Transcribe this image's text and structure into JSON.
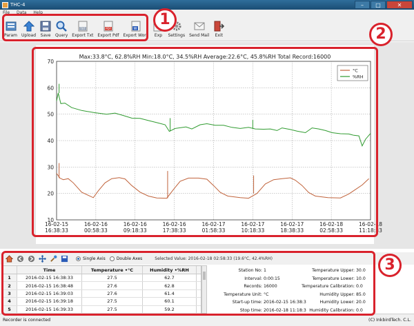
{
  "window": {
    "title": "THC-4"
  },
  "menu": [
    "File",
    "Data",
    "Help"
  ],
  "toolbar": [
    {
      "label": "Param",
      "icon": "param-icon"
    },
    {
      "label": "Upload",
      "icon": "upload-icon"
    },
    {
      "label": "Save",
      "icon": "save-icon"
    },
    {
      "label": "Query",
      "icon": "query-icon"
    },
    {
      "label": "Export Txt",
      "icon": "export-txt-icon"
    },
    {
      "label": "Export Pdf",
      "icon": "export-pdf-icon"
    },
    {
      "label": "Export Word",
      "icon": "export-word-icon"
    },
    {
      "label": "Exp",
      "icon": "export-icon"
    },
    {
      "label": "Settings",
      "icon": "settings-icon"
    },
    {
      "label": "Send Mail",
      "icon": "mail-icon"
    },
    {
      "label": "Exit",
      "icon": "exit-icon"
    }
  ],
  "annotations": [
    "1",
    "2",
    "3"
  ],
  "stats_text": "Max:33.8°C, 62.8%RH  Min:18.0°C, 34.5%RH  Average:22.6°C, 45.8%RH  Total Record:16000",
  "chart_data": {
    "type": "line",
    "ylim": [
      10,
      70
    ],
    "yticks": [
      10,
      20,
      30,
      40,
      50,
      60,
      70
    ],
    "xticks": [
      {
        "date": "16-02-15",
        "time": "16:38:33"
      },
      {
        "date": "16-02-16",
        "time": "00:58:33"
      },
      {
        "date": "16-02-16",
        "time": "09:18:33"
      },
      {
        "date": "16-02-16",
        "time": "17:38:33"
      },
      {
        "date": "16-02-17",
        "time": "01:58:33"
      },
      {
        "date": "16-02-17",
        "time": "10:18:33"
      },
      {
        "date": "16-02-17",
        "time": "18:38:33"
      },
      {
        "date": "16-02-18",
        "time": "02:58:33"
      },
      {
        "date": "16-02-18",
        "time": "11:18:33"
      }
    ],
    "grid": true,
    "legend_position": "top-right",
    "series": [
      {
        "name": "°C",
        "color": "#c0623a",
        "points": [
          [
            0,
            27.6
          ],
          [
            0.04,
            25.8
          ],
          [
            0.08,
            25.2
          ],
          [
            0.14,
            25.6
          ],
          [
            0.2,
            24.0
          ],
          [
            0.3,
            20.5
          ],
          [
            0.44,
            18.4
          ],
          [
            0.5,
            21.0
          ],
          [
            0.58,
            24.0
          ],
          [
            0.66,
            25.6
          ],
          [
            0.75,
            26.0
          ],
          [
            0.82,
            25.5
          ],
          [
            0.9,
            23.0
          ],
          [
            1.0,
            20.5
          ],
          [
            1.1,
            19.0
          ],
          [
            1.2,
            18.3
          ],
          [
            1.32,
            18.2
          ],
          [
            1.4,
            21.5
          ],
          [
            1.48,
            24.6
          ],
          [
            1.58,
            25.8
          ],
          [
            1.7,
            25.8
          ],
          [
            1.8,
            25.4
          ],
          [
            1.88,
            23.0
          ],
          [
            1.96,
            20.4
          ],
          [
            2.05,
            19.0
          ],
          [
            2.2,
            18.4
          ],
          [
            2.3,
            18.2
          ],
          [
            2.4,
            20.0
          ],
          [
            2.5,
            23.6
          ],
          [
            2.6,
            25.2
          ],
          [
            2.7,
            25.6
          ],
          [
            2.8,
            25.9
          ],
          [
            2.86,
            25.0
          ],
          [
            2.94,
            23.0
          ],
          [
            3.02,
            20.3
          ],
          [
            3.1,
            19.0
          ],
          [
            3.25,
            18.4
          ],
          [
            3.4,
            18.3
          ],
          [
            3.5,
            19.8
          ],
          [
            3.58,
            21.5
          ],
          [
            3.66,
            23.2
          ],
          [
            3.74,
            25.6
          ]
        ]
      },
      {
        "name": "%RH",
        "color": "#2f9b2f",
        "points": [
          [
            0,
            55.0
          ],
          [
            0.02,
            58.0
          ],
          [
            0.05,
            54.0
          ],
          [
            0.1,
            54.2
          ],
          [
            0.18,
            52.5
          ],
          [
            0.3,
            51.4
          ],
          [
            0.45,
            50.6
          ],
          [
            0.6,
            50.0
          ],
          [
            0.7,
            50.4
          ],
          [
            0.8,
            49.5
          ],
          [
            0.9,
            48.5
          ],
          [
            1.0,
            48.4
          ],
          [
            1.1,
            47.6
          ],
          [
            1.2,
            46.8
          ],
          [
            1.3,
            46.0
          ],
          [
            1.35,
            43.5
          ],
          [
            1.42,
            44.6
          ],
          [
            1.55,
            45.2
          ],
          [
            1.62,
            44.4
          ],
          [
            1.72,
            46.0
          ],
          [
            1.8,
            46.4
          ],
          [
            1.9,
            45.8
          ],
          [
            2.0,
            45.8
          ],
          [
            2.1,
            45.0
          ],
          [
            2.2,
            44.6
          ],
          [
            2.3,
            45.0
          ],
          [
            2.38,
            44.4
          ],
          [
            2.48,
            44.3
          ],
          [
            2.56,
            44.4
          ],
          [
            2.64,
            43.8
          ],
          [
            2.7,
            44.8
          ],
          [
            2.8,
            44.2
          ],
          [
            2.88,
            43.6
          ],
          [
            2.98,
            43.0
          ],
          [
            3.06,
            44.8
          ],
          [
            3.14,
            44.4
          ],
          [
            3.22,
            43.8
          ],
          [
            3.3,
            43.0
          ],
          [
            3.4,
            42.6
          ],
          [
            3.5,
            42.5
          ],
          [
            3.56,
            42.0
          ],
          [
            3.62,
            41.8
          ],
          [
            3.66,
            38.0
          ],
          [
            3.7,
            40.5
          ],
          [
            3.76,
            42.7
          ]
        ]
      }
    ],
    "x_range": [
      0,
      3.76
    ],
    "spikes": [
      {
        "series": 0,
        "x": 0.03,
        "y": 31.5
      },
      {
        "series": 1,
        "x": 0.03,
        "y": 61.5
      },
      {
        "series": 0,
        "x": 1.33,
        "y": 28.5
      },
      {
        "series": 1,
        "x": 1.36,
        "y": 48.5
      },
      {
        "series": 0,
        "x": 2.36,
        "y": 26.8
      },
      {
        "series": 1,
        "x": 2.35,
        "y": 47.8
      }
    ]
  },
  "bottom_toolbar": {
    "icons": [
      "home-icon",
      "back-icon",
      "forward-icon",
      "pan-icon",
      "brush-icon",
      "save-image-icon"
    ],
    "single_axis": "Single Axis",
    "double_axes": "Double Axes",
    "selected_value": "Selected Value: 2016-02-18 02:58:33 (19.6°C, 42.4%RH)"
  },
  "table": {
    "headers": [
      "",
      "Time",
      "Temperature •°C",
      "Humidity •%RH"
    ],
    "rows": [
      [
        "1",
        "2016-02-15 16:38:33",
        "27.5",
        "62.7"
      ],
      [
        "2",
        "2016-02-15 16:38:48",
        "27.6",
        "62.8"
      ],
      [
        "3",
        "2016-02-15 16:39:03",
        "27.6",
        "61.4"
      ],
      [
        "4",
        "2016-02-15 16:39:18",
        "27.5",
        "60.1"
      ],
      [
        "5",
        "2016-02-15 16:39:33",
        "27.5",
        "59.2"
      ]
    ]
  },
  "info_left": [
    {
      "label": "Station No:",
      "value": "1"
    },
    {
      "label": "Interval:",
      "value": "0:00:15"
    },
    {
      "label": "Records:",
      "value": "16000"
    },
    {
      "label": "Temperature Unit:",
      "value": "°C"
    },
    {
      "label": "Start-up time:",
      "value": "2016-02-15 16:38:3"
    },
    {
      "label": "Stop time:",
      "value": "2016-02-18 11:18:3"
    }
  ],
  "info_right": [
    {
      "label": "Temperature Upper:",
      "value": "30.0"
    },
    {
      "label": "Temperature Lower:",
      "value": "10.0"
    },
    {
      "label": "Temperature Calibration:",
      "value": "0.0"
    },
    {
      "label": "Humidity Upper:",
      "value": "85.0"
    },
    {
      "label": "Humidity Lower:",
      "value": "20.0"
    },
    {
      "label": "Humidity Calibration:",
      "value": "0.0"
    }
  ],
  "status": {
    "left": "Recorder is connected",
    "right": "(C) InkbirdTech. C.L."
  },
  "colors": {
    "annotation": "#d9222c",
    "temp": "#c0623a",
    "humidity": "#2f9b2f"
  }
}
